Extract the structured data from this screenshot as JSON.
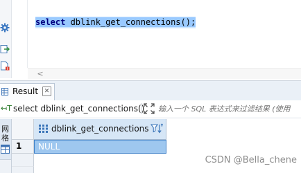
{
  "editor": {
    "sql_keyword": "select",
    "sql_rest": " dblink_get_connections();",
    "scroll_left_arrow": "<"
  },
  "gutter_icons": [
    "gear-icon",
    "export-icon",
    "file-error-icon"
  ],
  "result_tab": {
    "label": "Result",
    "close_glyph": "✕"
  },
  "filter_bar": {
    "sql_icon": "↤T",
    "query": "select dblink_get_connections()",
    "placeholder": "输入一个 SQL 表达式来过滤结果 (使用"
  },
  "side_tab": {
    "label": "网格"
  },
  "grid": {
    "column_header": "dblink_get_connections",
    "rows": [
      {
        "number": "1",
        "value": "NULL"
      }
    ]
  },
  "watermark": "CSDN @Bella_chene",
  "colors": {
    "selection": "#99c9ff",
    "header_bg": "#d6e6f6",
    "selected_cell": "#9ec7ef"
  }
}
